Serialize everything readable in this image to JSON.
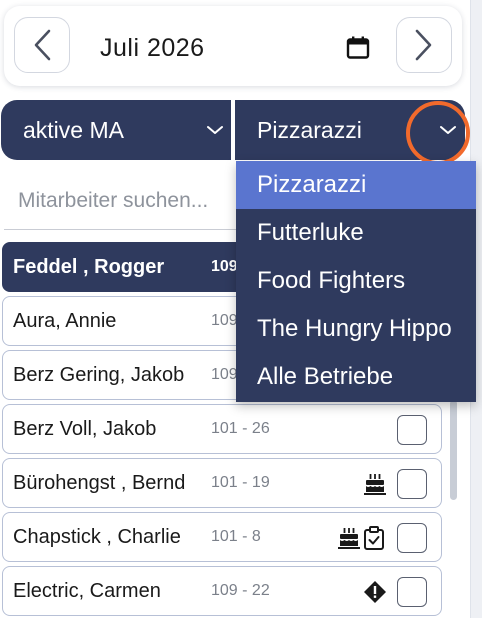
{
  "month_nav": {
    "month_value": "Juli 2026",
    "prev_icon": "chevron-left-icon",
    "next_icon": "chevron-right-icon",
    "calendar_icon": "calendar-icon"
  },
  "filters": {
    "employee_filter": "aktive MA",
    "business_filter": "Pizzarazzi"
  },
  "search": {
    "placeholder": "Mitarbeiter suchen..."
  },
  "employees": [
    {
      "name": "Feddel , Rogger",
      "code": "109",
      "header": true
    },
    {
      "name": "Aura, Annie",
      "code": "109"
    },
    {
      "name": "Berz Gering, Jakob",
      "code": "109"
    },
    {
      "name": "Berz Voll, Jakob",
      "code": "101 - 26"
    },
    {
      "name": "Bürohengst , Bernd",
      "code": "101 - 19",
      "icons": [
        "birthday-cake-icon"
      ]
    },
    {
      "name": "Chapstick , Charlie",
      "code": "101 - 8",
      "icons": [
        "birthday-cake-icon",
        "clipboard-check-icon"
      ]
    },
    {
      "name": "Electric, Carmen",
      "code": "109 - 22",
      "icons": [
        "warning-diamond-icon"
      ]
    }
  ],
  "dropdown": {
    "options": [
      "Pizzarazzi",
      "Futterluke",
      "Food Fighters",
      "The Hungry Hippo",
      "Alle Betriebe"
    ],
    "selected": "Pizzarazzi"
  },
  "colors": {
    "navy": "#2f3a5e",
    "selected_option": "#5a75cf",
    "highlight_ring": "#f26a2c"
  }
}
